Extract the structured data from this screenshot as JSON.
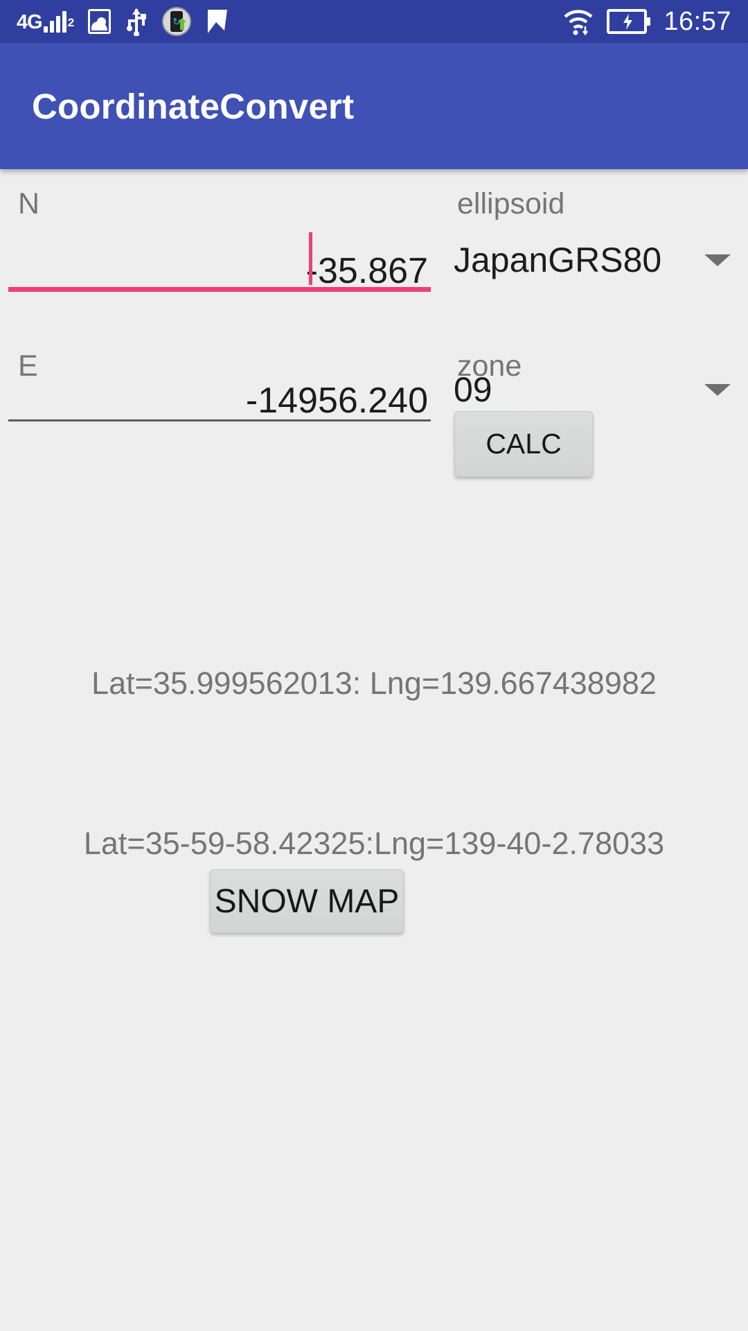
{
  "status_bar": {
    "network_label": "4G",
    "network_sub": "2",
    "time": "16:57",
    "icons": [
      "signal-4g-icon",
      "photo-icon",
      "usb-icon",
      "phone-sync-icon",
      "checkmark-flag-icon",
      "wifi-icon",
      "battery-charging-icon"
    ],
    "background_color": "#303f9f"
  },
  "app_bar": {
    "title": "CoordinateConvert",
    "background_color": "#3f51b5",
    "text_color": "#ffffff"
  },
  "form": {
    "north": {
      "label": "N",
      "value": "-35.867",
      "focused": true,
      "accent_color": "#ec407a"
    },
    "east": {
      "label": "E",
      "value": "-14956.240",
      "focused": false,
      "underline_color": "#5b5b5b"
    },
    "ellipsoid": {
      "label": "ellipsoid",
      "selected": "JapanGRS80"
    },
    "zone": {
      "label": "zone",
      "selected": "09"
    }
  },
  "buttons": {
    "calc": "CALC",
    "snow_map": "SNOW MAP"
  },
  "results": {
    "decimal": "Lat=35.999562013: Lng=139.667438982",
    "dms": "Lat=35-59-58.42325:Lng=139-40-2.78033"
  }
}
